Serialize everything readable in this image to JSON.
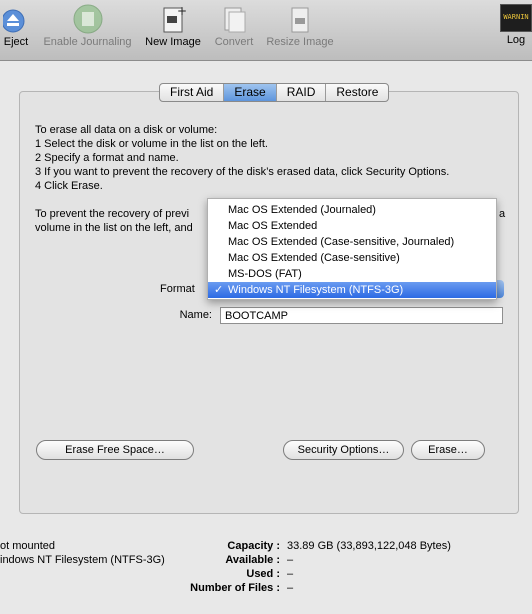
{
  "toolbar": {
    "eject": "Eject",
    "enable_journaling": "Enable Journaling",
    "new_image": "New Image",
    "convert": "Convert",
    "resize_image": "Resize Image",
    "log": "Log",
    "log_badge": "WARNIN"
  },
  "tabs": [
    "First Aid",
    "Erase",
    "RAID",
    "Restore"
  ],
  "selected_tab": "Erase",
  "instructions": {
    "line1": "To erase all data on a disk or volume:",
    "line2": "1 Select the disk or volume in the list on the left.",
    "line3": "2 Specify a format and name.",
    "line4": "3 If you want to prevent the recovery of the disk’s erased data, click Security Options.",
    "line5": "4 Click Erase.",
    "para2_line1": "To prevent the recovery of previ",
    "para2_line2": "volume in the list on the left, and",
    "para2_tail1": "a",
    "para2_tail2": ""
  },
  "format": {
    "label": "Format",
    "options": [
      "Mac OS Extended (Journaled)",
      "Mac OS Extended",
      "Mac OS Extended (Case-sensitive, Journaled)",
      "Mac OS Extended (Case-sensitive)",
      "MS-DOS (FAT)",
      "Windows NT Filesystem (NTFS-3G)"
    ],
    "selected": "Windows NT Filesystem (NTFS-3G)",
    "check": "✓"
  },
  "name": {
    "label": "Name:",
    "value": "BOOTCAMP"
  },
  "buttons": {
    "erase_free_space": "Erase Free Space…",
    "security_options": "Security Options…",
    "erase": "Erase…"
  },
  "info": {
    "mount_status": "ot mounted",
    "filesystem": "indows NT Filesystem (NTFS-3G)",
    "capacity_label": "Capacity :",
    "capacity_value": "33.89 GB (33,893,122,048 Bytes)",
    "available_label": "Available :",
    "available_value": "–",
    "used_label": "Used :",
    "used_value": "–",
    "files_label": "Number of Files :",
    "files_value": "–"
  },
  "colors": {
    "selection": "#3470e6",
    "tab_selected": "#7aa9e6"
  }
}
